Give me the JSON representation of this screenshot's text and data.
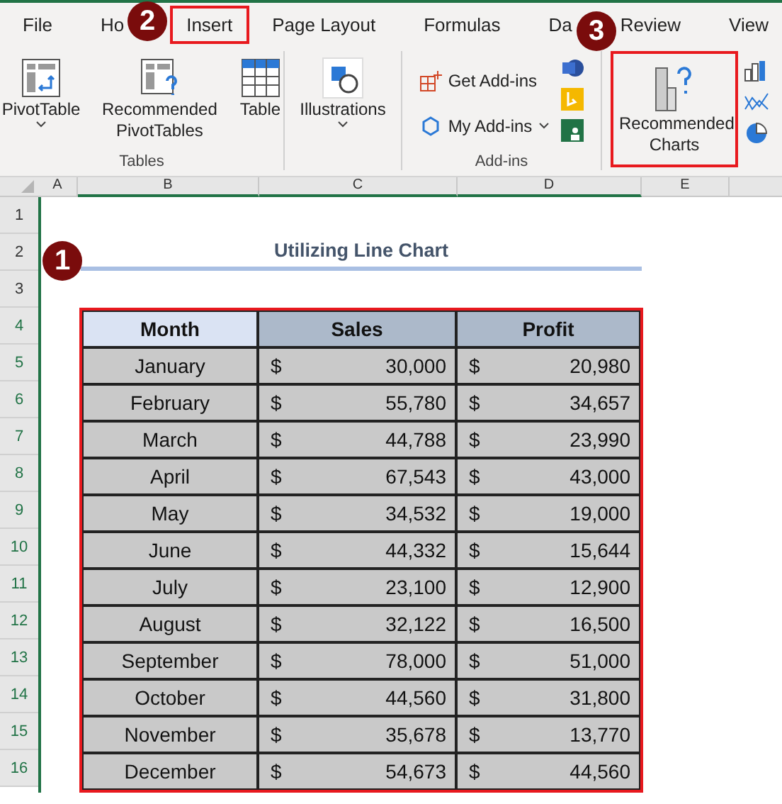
{
  "tabs": [
    {
      "label": "File",
      "selected": false
    },
    {
      "label": "Ho",
      "selected": false
    },
    {
      "label": "Insert",
      "selected": true
    },
    {
      "label": "Page Layout",
      "selected": false
    },
    {
      "label": "Formulas",
      "selected": false
    },
    {
      "label": "Da",
      "selected": false
    },
    {
      "label": "Review",
      "selected": false
    },
    {
      "label": "View",
      "selected": false
    }
  ],
  "ribbon": {
    "tables": {
      "label": "Tables",
      "buttons": [
        {
          "kind": "pivot",
          "label": "PivotTable",
          "dropdown": true
        },
        {
          "kind": "recpivot",
          "label": "Recommended PivotTables",
          "dropdown": false
        },
        {
          "kind": "table",
          "label": "Table",
          "dropdown": false
        }
      ]
    },
    "illustrations": {
      "label": "Illustrations"
    },
    "addins": {
      "label": "Add-ins",
      "get": "Get Add-ins",
      "mine": "My Add-ins"
    },
    "charts": {
      "label": "Recommended Charts",
      "highlighted": true
    }
  },
  "columns": [
    "A",
    "B",
    "C",
    "D",
    "E"
  ],
  "rows": [
    "1",
    "2",
    "3",
    "4",
    "5",
    "6",
    "7",
    "8",
    "9",
    "10",
    "11",
    "12",
    "13",
    "14",
    "15",
    "16"
  ],
  "title": "Utilizing Line Chart",
  "table": {
    "headers": [
      "Month",
      "Sales",
      "Profit"
    ],
    "highlighted": true,
    "rows": [
      [
        "January",
        "$",
        "30,000",
        "$",
        "20,980"
      ],
      [
        "February",
        "$",
        "55,780",
        "$",
        "34,657"
      ],
      [
        "March",
        "$",
        "44,788",
        "$",
        "23,990"
      ],
      [
        "April",
        "$",
        "67,543",
        "$",
        "43,000"
      ],
      [
        "May",
        "$",
        "34,532",
        "$",
        "19,000"
      ],
      [
        "June",
        "$",
        "44,332",
        "$",
        "15,644"
      ],
      [
        "July",
        "$",
        "23,100",
        "$",
        "12,900"
      ],
      [
        "August",
        "$",
        "32,122",
        "$",
        "16,500"
      ],
      [
        "September",
        "$",
        "78,000",
        "$",
        "51,000"
      ],
      [
        "October",
        "$",
        "44,560",
        "$",
        "31,800"
      ],
      [
        "November",
        "$",
        "35,678",
        "$",
        "13,770"
      ],
      [
        "December",
        "$",
        "54,673",
        "$",
        "44,560"
      ]
    ]
  },
  "badges": [
    "1",
    "2",
    "3"
  ]
}
